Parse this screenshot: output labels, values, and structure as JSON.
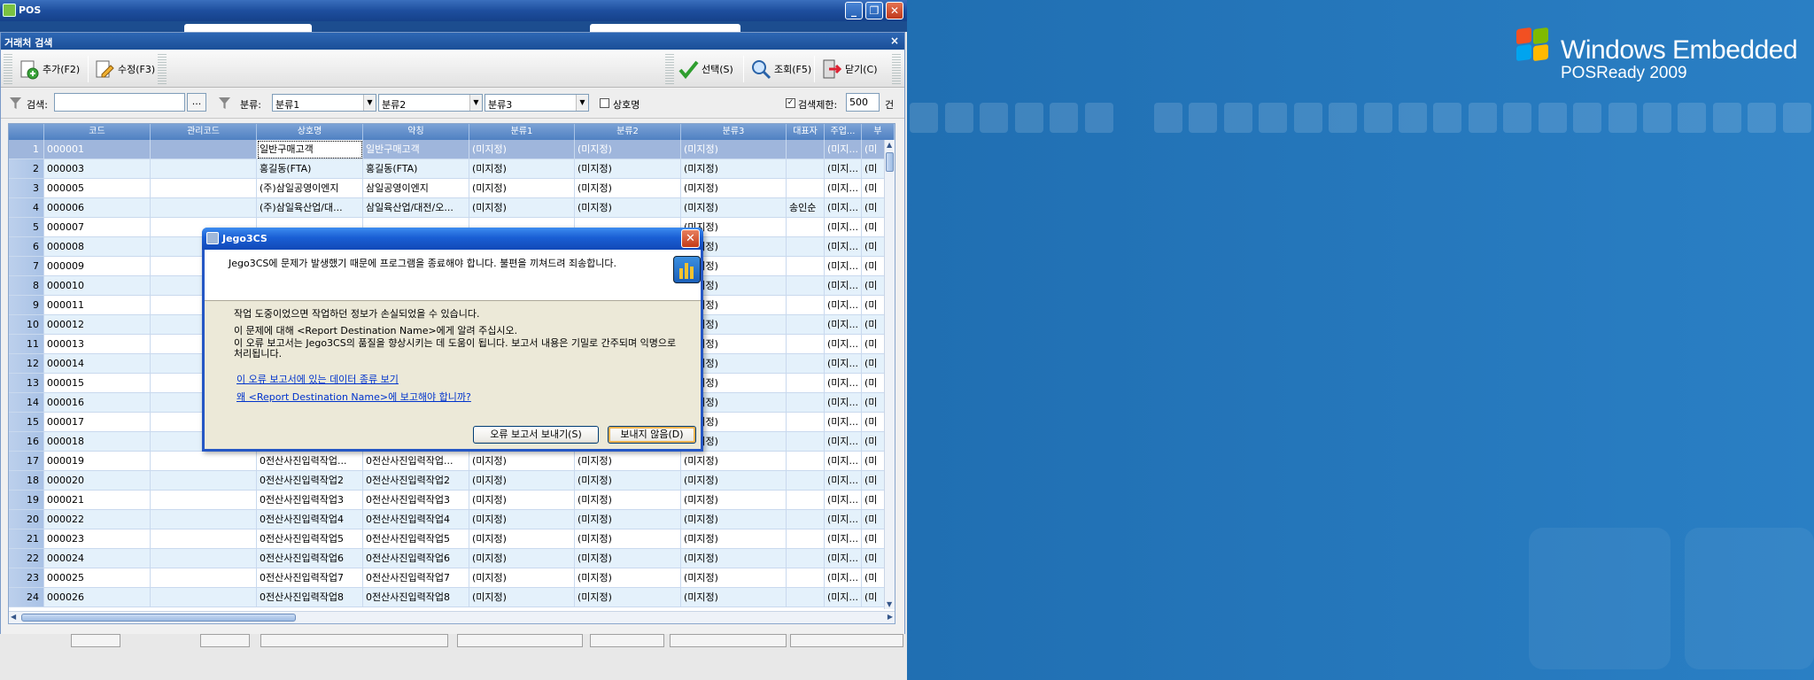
{
  "desktop": {
    "brand_line1": "Windows Embedded",
    "brand_line2": "POSReady 2009"
  },
  "window": {
    "title": "POS"
  },
  "form": {
    "title": "거래처 검색",
    "toolbar": {
      "add_label": "추가(F2)",
      "edit_label": "수정(F3)",
      "select_label": "선택(S)",
      "query_label": "조회(F5)",
      "close_label": "닫기(C)"
    },
    "filter": {
      "search_label": "검색:",
      "search_value": "",
      "browse_label": "...",
      "category_label": "분류:",
      "category1": "분류1",
      "category2": "분류2",
      "category3": "분류3",
      "company_label": "상호명",
      "company_checked": false,
      "limit_label": "검색제한:",
      "limit_checked": true,
      "limit_value": "500",
      "limit_unit": "건"
    },
    "grid": {
      "columns": [
        "코드",
        "관리코드",
        "상호명",
        "약칭",
        "분류1",
        "분류2",
        "분류3",
        "대표자",
        "주업...",
        "부"
      ],
      "rows": [
        {
          "n": "1",
          "code": "000001",
          "mgmt": "",
          "name": "일반구매고객",
          "short": "일반구매고객",
          "c1": "(미지정)",
          "c2": "(미지정)",
          "c3": "(미지정)",
          "rep": "",
          "biz": "(미지...",
          "b": "(미"
        },
        {
          "n": "2",
          "code": "000003",
          "mgmt": "",
          "name": "홍길동(FTA)",
          "short": "홍길동(FTA)",
          "c1": "(미지정)",
          "c2": "(미지정)",
          "c3": "(미지정)",
          "rep": "",
          "biz": "(미지...",
          "b": "(미"
        },
        {
          "n": "3",
          "code": "000005",
          "mgmt": "",
          "name": "(주)삼일공영이엔지",
          "short": "삼일공영이엔지",
          "c1": "(미지정)",
          "c2": "(미지정)",
          "c3": "(미지정)",
          "rep": "",
          "biz": "(미지...",
          "b": "(미"
        },
        {
          "n": "4",
          "code": "000006",
          "mgmt": "",
          "name": "(주)삼일육산업/대...",
          "short": "삼일육산업/대전/오...",
          "c1": "(미지정)",
          "c2": "(미지정)",
          "c3": "(미지정)",
          "rep": "송인순",
          "biz": "(미지...",
          "b": "(미"
        },
        {
          "n": "5",
          "code": "000007",
          "mgmt": "",
          "name": "",
          "short": "",
          "c1": "",
          "c2": "",
          "c3": "(미지정)",
          "rep": "",
          "biz": "(미지...",
          "b": "(미"
        },
        {
          "n": "6",
          "code": "000008",
          "mgmt": "",
          "name": "",
          "short": "",
          "c1": "",
          "c2": "",
          "c3": "(미지정)",
          "rep": "",
          "biz": "(미지...",
          "b": "(미"
        },
        {
          "n": "7",
          "code": "000009",
          "mgmt": "",
          "name": "",
          "short": "",
          "c1": "",
          "c2": "",
          "c3": "(미지정)",
          "rep": "",
          "biz": "(미지...",
          "b": "(미"
        },
        {
          "n": "8",
          "code": "000010",
          "mgmt": "",
          "name": "",
          "short": "",
          "c1": "",
          "c2": "",
          "c3": "(미지정)",
          "rep": "",
          "biz": "(미지...",
          "b": "(미"
        },
        {
          "n": "9",
          "code": "000011",
          "mgmt": "",
          "name": "",
          "short": "",
          "c1": "",
          "c2": "",
          "c3": "(미지정)",
          "rep": "",
          "biz": "(미지...",
          "b": "(미"
        },
        {
          "n": "10",
          "code": "000012",
          "mgmt": "",
          "name": "",
          "short": "",
          "c1": "",
          "c2": "",
          "c3": "(미지정)",
          "rep": "",
          "biz": "(미지...",
          "b": "(미"
        },
        {
          "n": "11",
          "code": "000013",
          "mgmt": "",
          "name": "",
          "short": "",
          "c1": "",
          "c2": "",
          "c3": "(미지정)",
          "rep": "",
          "biz": "(미지...",
          "b": "(미"
        },
        {
          "n": "12",
          "code": "000014",
          "mgmt": "",
          "name": "",
          "short": "",
          "c1": "",
          "c2": "",
          "c3": "(미지정)",
          "rep": "",
          "biz": "(미지...",
          "b": "(미"
        },
        {
          "n": "13",
          "code": "000015",
          "mgmt": "",
          "name": "",
          "short": "",
          "c1": "",
          "c2": "",
          "c3": "(미지정)",
          "rep": "",
          "biz": "(미지...",
          "b": "(미"
        },
        {
          "n": "14",
          "code": "000016",
          "mgmt": "",
          "name": "",
          "short": "",
          "c1": "",
          "c2": "",
          "c3": "(미지정)",
          "rep": "",
          "biz": "(미지...",
          "b": "(미"
        },
        {
          "n": "15",
          "code": "000017",
          "mgmt": "",
          "name": "",
          "short": "",
          "c1": "",
          "c2": "",
          "c3": "(미지정)",
          "rep": "",
          "biz": "(미지...",
          "b": "(미"
        },
        {
          "n": "16",
          "code": "000018",
          "mgmt": "",
          "name": "",
          "short": "",
          "c1": "",
          "c2": "",
          "c3": "(미지정)",
          "rep": "",
          "biz": "(미지...",
          "b": "(미"
        },
        {
          "n": "17",
          "code": "000019",
          "mgmt": "",
          "name": "0전산사진입력작업...",
          "short": "0전산사진입력작업...",
          "c1": "(미지정)",
          "c2": "(미지정)",
          "c3": "(미지정)",
          "rep": "",
          "biz": "(미지...",
          "b": "(미"
        },
        {
          "n": "18",
          "code": "000020",
          "mgmt": "",
          "name": "0전산사진입력작업2",
          "short": "0전산사진입력작업2",
          "c1": "(미지정)",
          "c2": "(미지정)",
          "c3": "(미지정)",
          "rep": "",
          "biz": "(미지...",
          "b": "(미"
        },
        {
          "n": "19",
          "code": "000021",
          "mgmt": "",
          "name": "0전산사진입력작업3",
          "short": "0전산사진입력작업3",
          "c1": "(미지정)",
          "c2": "(미지정)",
          "c3": "(미지정)",
          "rep": "",
          "biz": "(미지...",
          "b": "(미"
        },
        {
          "n": "20",
          "code": "000022",
          "mgmt": "",
          "name": "0전산사진입력작업4",
          "short": "0전산사진입력작업4",
          "c1": "(미지정)",
          "c2": "(미지정)",
          "c3": "(미지정)",
          "rep": "",
          "biz": "(미지...",
          "b": "(미"
        },
        {
          "n": "21",
          "code": "000023",
          "mgmt": "",
          "name": "0전산사진입력작업5",
          "short": "0전산사진입력작업5",
          "c1": "(미지정)",
          "c2": "(미지정)",
          "c3": "(미지정)",
          "rep": "",
          "biz": "(미지...",
          "b": "(미"
        },
        {
          "n": "22",
          "code": "000024",
          "mgmt": "",
          "name": "0전산사진입력작업6",
          "short": "0전산사진입력작업6",
          "c1": "(미지정)",
          "c2": "(미지정)",
          "c3": "(미지정)",
          "rep": "",
          "biz": "(미지...",
          "b": "(미"
        },
        {
          "n": "23",
          "code": "000025",
          "mgmt": "",
          "name": "0전산사진입력작업7",
          "short": "0전산사진입력작업7",
          "c1": "(미지정)",
          "c2": "(미지정)",
          "c3": "(미지정)",
          "rep": "",
          "biz": "(미지...",
          "b": "(미"
        },
        {
          "n": "24",
          "code": "000026",
          "mgmt": "",
          "name": "0전산사진입력작업8",
          "short": "0전산사진입력작업8",
          "c1": "(미지정)",
          "c2": "(미지정)",
          "c3": "(미지정)",
          "rep": "",
          "biz": "(미지...",
          "b": "(미"
        }
      ]
    }
  },
  "dialog": {
    "title": "Jego3CS",
    "message": "Jego3CS에 문제가 발생했기 때문에 프로그램을 종료해야 합니다. 불편을 끼쳐드려 죄송합니다.",
    "body1": "작업 도중이었으면 작업하던 정보가 손실되었을 수 있습니다.",
    "body2": "이 문제에 대해 <Report Destination Name>에게 알려 주십시오.",
    "body3": "이 오류 보고서는 Jego3CS의 품질을 향상시키는 데 도움이 됩니다. 보고서 내용은 기밀로 간주되며 익명으로 처리됩니다.",
    "link1": "이 오류 보고서에 있는 데이터 종류 보기",
    "link2": "왜 <Report Destination Name>에 보고해야 합니까?",
    "send_label": "오류 보고서 보내기(S)",
    "dont_send_label": "보내지 않음(D)"
  },
  "colors": {
    "titlebar": "#1e4f9e",
    "grid_header": "#5a8ac8",
    "row_alt": "#e4f1fb",
    "row_selected": "#9fb6dc",
    "dialog_title": "#1a5fd4",
    "link": "#0033cc"
  }
}
